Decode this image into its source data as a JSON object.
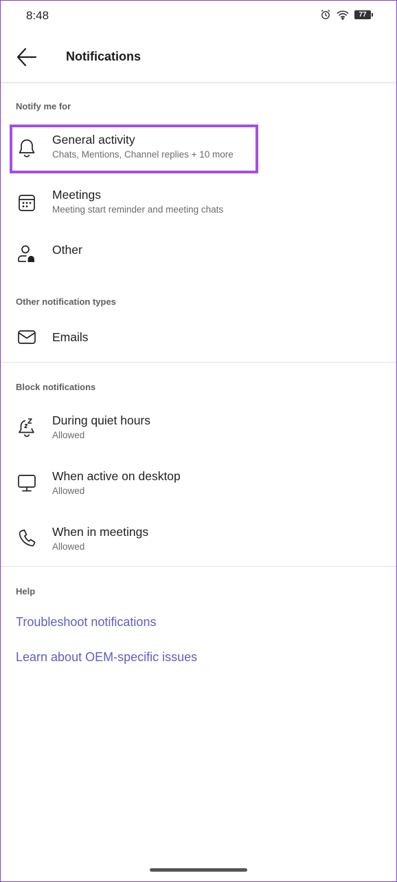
{
  "status_bar": {
    "time": "8:48",
    "battery": "77"
  },
  "header": {
    "title": "Notifications"
  },
  "sections": {
    "notify_me_for": {
      "title": "Notify me for",
      "items": [
        {
          "title": "General activity",
          "subtitle": "Chats, Mentions, Channel replies + 10 more",
          "icon": "bell-icon"
        },
        {
          "title": "Meetings",
          "subtitle": "Meeting start reminder and meeting chats",
          "icon": "calendar-icon"
        },
        {
          "title": "Other",
          "icon": "person-bell-icon"
        }
      ]
    },
    "other_types": {
      "title": "Other notification types",
      "items": [
        {
          "title": "Emails",
          "icon": "mail-icon"
        }
      ]
    },
    "block": {
      "title": "Block notifications",
      "items": [
        {
          "title": "During quiet hours",
          "subtitle": "Allowed",
          "icon": "snooze-bell-icon"
        },
        {
          "title": "When active on desktop",
          "subtitle": "Allowed",
          "icon": "desktop-icon"
        },
        {
          "title": "When in meetings",
          "subtitle": "Allowed",
          "icon": "phone-icon"
        }
      ]
    },
    "help": {
      "title": "Help",
      "links": [
        {
          "label": "Troubleshoot notifications"
        },
        {
          "label": "Learn about OEM-specific issues"
        }
      ]
    }
  },
  "colors": {
    "link": "#5b5fc7",
    "highlight": "#a24ee8"
  }
}
